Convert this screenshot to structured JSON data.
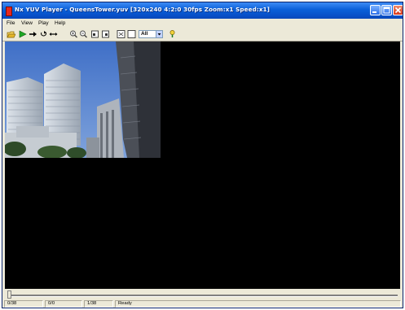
{
  "window": {
    "title": "Nx YUV Player - QueensTower.yuv [320x240 4:2:0 30fps Zoom:x1 Speed:x1]"
  },
  "menu": {
    "items": [
      "File",
      "View",
      "Play",
      "Help"
    ]
  },
  "toolbar": {
    "icons": [
      "open-icon",
      "play-icon",
      "step-forward-icon",
      "loop-icon",
      "bounce-icon",
      "zoom-in-icon",
      "zoom-out-icon",
      "frame-back-icon",
      "frame-forward-icon",
      "fit-icon",
      "fullscreen-icon",
      "help-icon"
    ],
    "component_select": "All"
  },
  "seek": {
    "position_fraction": 0.0
  },
  "status": {
    "frame": "0/38",
    "index": "0/0",
    "page": "1/38",
    "state": "Ready"
  },
  "colors": {
    "title_bar": "#0a5fd8",
    "viewport": "#000000",
    "chrome": "#ece9d8"
  }
}
